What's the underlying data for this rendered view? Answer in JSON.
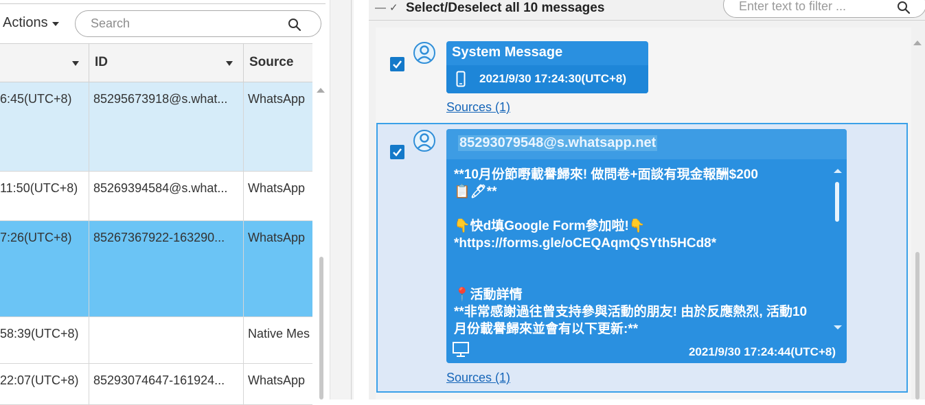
{
  "toolbar": {
    "actions_label": "Actions",
    "search_placeholder": "Search"
  },
  "table": {
    "columns": [
      {
        "label": ""
      },
      {
        "label": "ID"
      },
      {
        "label": "Source"
      }
    ],
    "rows": [
      {
        "time": "6:45(UTC+8)",
        "id": "85295673918@s.what...",
        "source": "WhatsApp",
        "state": "selected-light"
      },
      {
        "time": "11:50(UTC+8)",
        "id": "85269394584@s.what...",
        "source": "WhatsApp",
        "state": "normal"
      },
      {
        "time": "7:26(UTC+8)",
        "id": "85267367922-163290...",
        "source": "WhatsApp",
        "state": "selected"
      },
      {
        "time": "58:39(UTC+8)",
        "id": "",
        "source": "Native Mes",
        "state": "normal"
      },
      {
        "time": "22:07(UTC+8)",
        "id": "85293074647-161924...",
        "source": "WhatsApp",
        "state": "normal"
      }
    ]
  },
  "messages_panel": {
    "select_all_label": "Select/Deselect all 10 messages",
    "filter_placeholder": "Enter text to filter ...",
    "messages": [
      {
        "sender": "System Message",
        "timestamp": "2021/9/30 17:24:30(UTC+8)",
        "device_icon": "mobile-phone-icon",
        "sources_link": "Sources (1)",
        "checked": true
      },
      {
        "sender": "85293079548@s.whatsapp.net",
        "timestamp": "2021/9/30 17:24:44(UTC+8)",
        "device_icon": "desktop-monitor-icon",
        "sources_link": "Sources (1)",
        "checked": true,
        "body_lines": [
          "**10月份節嘢載譽歸來! 做問卷+面談有現金報酬$200",
          "📋🖊**",
          "",
          "👇快d填Google Form參加啦!👇",
          "*https://forms.gle/oCEQAqmQSYth5HCd8*",
          "",
          "",
          "📍活動詳情",
          "**非常感謝過往曾支持參與活動的朋友! 由於反應熱烈, 活動10",
          "月份載譽歸來並會有以下更新:**"
        ]
      }
    ]
  },
  "colors": {
    "bubble": "#2a90e0",
    "row_selected": "#6bc4f5",
    "row_selected_light": "#d6ecf9",
    "link": "#1565b8"
  }
}
